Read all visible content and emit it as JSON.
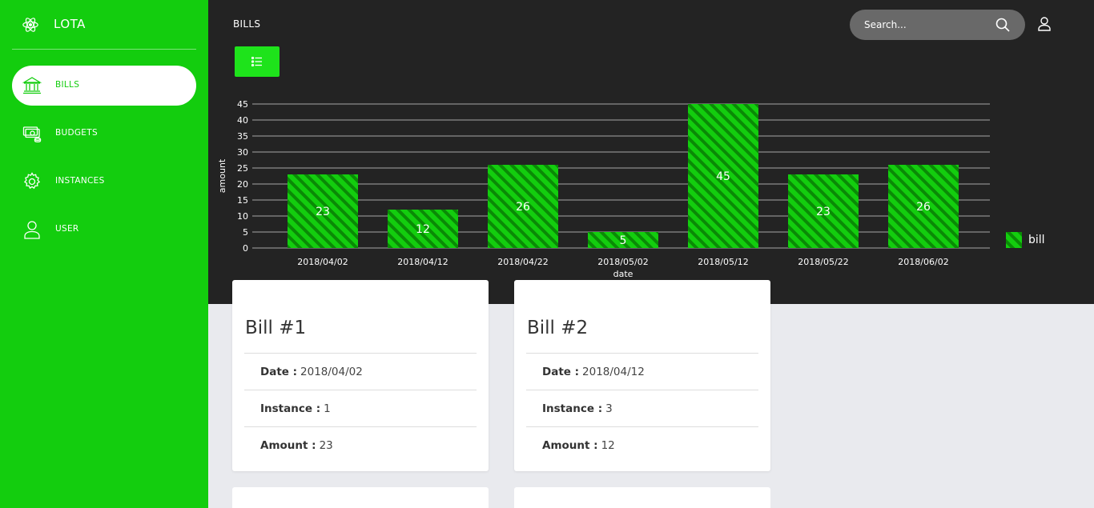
{
  "brand": {
    "name": "LOTA"
  },
  "sidebar": {
    "items": [
      {
        "label": "BILLS",
        "icon": "bank-icon",
        "active": true
      },
      {
        "label": "BUDGETS",
        "icon": "money-icon",
        "active": false
      },
      {
        "label": "INSTANCES",
        "icon": "gear-icon",
        "active": false
      },
      {
        "label": "USER",
        "icon": "user-icon",
        "active": false
      }
    ]
  },
  "header": {
    "title": "BILLS",
    "search_placeholder": "Search..."
  },
  "colors": {
    "accent": "#13cd0e",
    "bar": "#13cd0e",
    "bar_stripe": "#0a8a06",
    "panel": "#232323"
  },
  "chart_data": {
    "type": "bar",
    "categories": [
      "2018/04/02",
      "2018/04/12",
      "2018/04/22",
      "2018/05/02",
      "2018/05/12",
      "2018/05/22",
      "2018/06/02"
    ],
    "series": [
      {
        "name": "bill",
        "values": [
          23,
          12,
          26,
          5,
          45,
          23,
          26
        ]
      }
    ],
    "xlabel": "date",
    "ylabel": "amount",
    "ylim": [
      0,
      45
    ],
    "yticks": [
      0,
      5,
      10,
      15,
      20,
      25,
      30,
      35,
      40,
      45
    ],
    "grid": true,
    "legend": "right"
  },
  "cards": [
    {
      "title": "Bill #1",
      "date_label": "Date :",
      "date": "2018/04/02",
      "instance_label": "Instance :",
      "instance": "1",
      "amount_label": "Amount :",
      "amount": "23"
    },
    {
      "title": "Bill #2",
      "date_label": "Date :",
      "date": "2018/04/12",
      "instance_label": "Instance :",
      "instance": "3",
      "amount_label": "Amount :",
      "amount": "12"
    }
  ]
}
